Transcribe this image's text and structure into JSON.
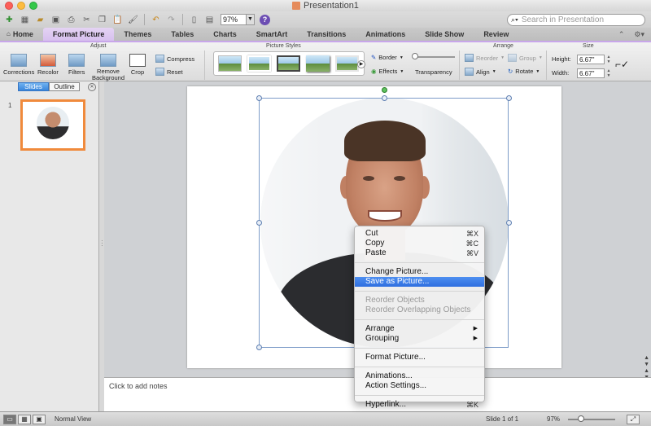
{
  "window": {
    "title": "Presentation1"
  },
  "toolbar": {
    "zoom": "97%",
    "search_placeholder": "Search in Presentation",
    "help": "?"
  },
  "tabs": [
    {
      "label": "Home"
    },
    {
      "label": "Format Picture"
    },
    {
      "label": "Themes"
    },
    {
      "label": "Tables"
    },
    {
      "label": "Charts"
    },
    {
      "label": "SmartArt"
    },
    {
      "label": "Transitions"
    },
    {
      "label": "Animations"
    },
    {
      "label": "Slide Show"
    },
    {
      "label": "Review"
    }
  ],
  "ribbon": {
    "groups": {
      "adjust": "Adjust",
      "picture_styles": "Picture Styles",
      "arrange": "Arrange",
      "size": "Size"
    },
    "corrections": "Corrections",
    "recolor": "Recolor",
    "filters": "Filters",
    "remove_background": "Remove Background",
    "crop": "Crop",
    "compress": "Compress",
    "reset": "Reset",
    "border": "Border",
    "effects": "Effects",
    "transparency": "Transparency",
    "reorder": "Reorder",
    "align": "Align",
    "group": "Group",
    "rotate": "Rotate",
    "height_label": "Height:",
    "height_value": "6.67\"",
    "width_label": "Width:",
    "width_value": "6.67\""
  },
  "left_pane": {
    "slides_tab": "Slides",
    "outline_tab": "Outline",
    "slide_number": "1"
  },
  "notes": {
    "placeholder": "Click to add notes"
  },
  "status": {
    "view": "Normal View",
    "slide_info": "Slide 1 of 1",
    "zoom": "97%"
  },
  "context_menu": {
    "items": [
      {
        "label": "Cut",
        "shortcut": "⌘X"
      },
      {
        "label": "Copy",
        "shortcut": "⌘C"
      },
      {
        "label": "Paste",
        "shortcut": "⌘V"
      },
      {
        "label": "Change Picture..."
      },
      {
        "label": "Save as Picture..."
      },
      {
        "label": "Reorder Objects"
      },
      {
        "label": "Reorder Overlapping Objects"
      },
      {
        "label": "Arrange"
      },
      {
        "label": "Grouping"
      },
      {
        "label": "Format Picture..."
      },
      {
        "label": "Animations..."
      },
      {
        "label": "Action Settings..."
      },
      {
        "label": "Hyperlink...",
        "shortcut": "⌘K"
      }
    ]
  }
}
